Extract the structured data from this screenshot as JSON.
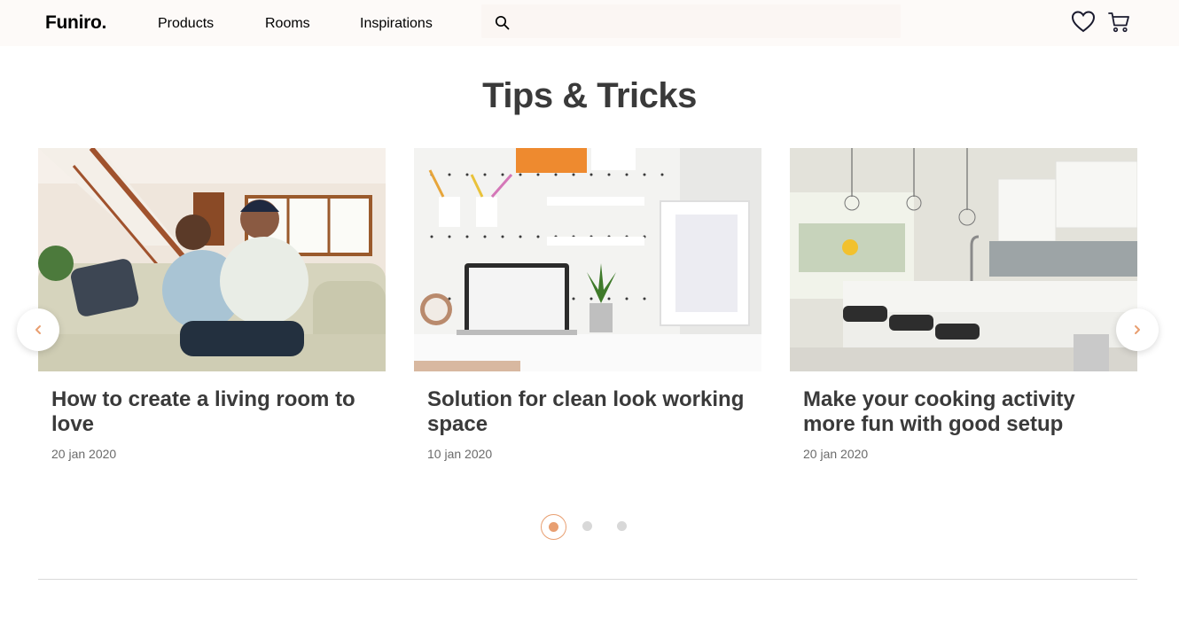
{
  "header": {
    "logo": "Funiro.",
    "nav": [
      {
        "label": "Products"
      },
      {
        "label": "Rooms"
      },
      {
        "label": "Inspirations"
      }
    ],
    "icons": {
      "search": "search-icon",
      "wishlist": "heart-icon",
      "cart": "cart-icon"
    }
  },
  "section": {
    "title": "Tips & Tricks"
  },
  "cards": [
    {
      "title": "How to create a living room to love",
      "date": "20 jan 2020",
      "image": "living-room-couple-photo"
    },
    {
      "title": "Solution for clean look working space",
      "date": "10 jan 2020",
      "image": "workspace-laptop-photo"
    },
    {
      "title": "Make your cooking activity more fun with good setup",
      "date": "20 jan 2020",
      "image": "kitchen-island-photo"
    }
  ],
  "carousel": {
    "prev_icon": "chevron-left-icon",
    "next_icon": "chevron-right-icon",
    "active_index": 0,
    "page_count": 3
  },
  "colors": {
    "accent": "#e89f71",
    "header_bg": "#fdfaf8",
    "title_text": "#3a3a3a",
    "muted_text": "#6b6b6b",
    "dot_inactive": "#d8d8d8"
  }
}
